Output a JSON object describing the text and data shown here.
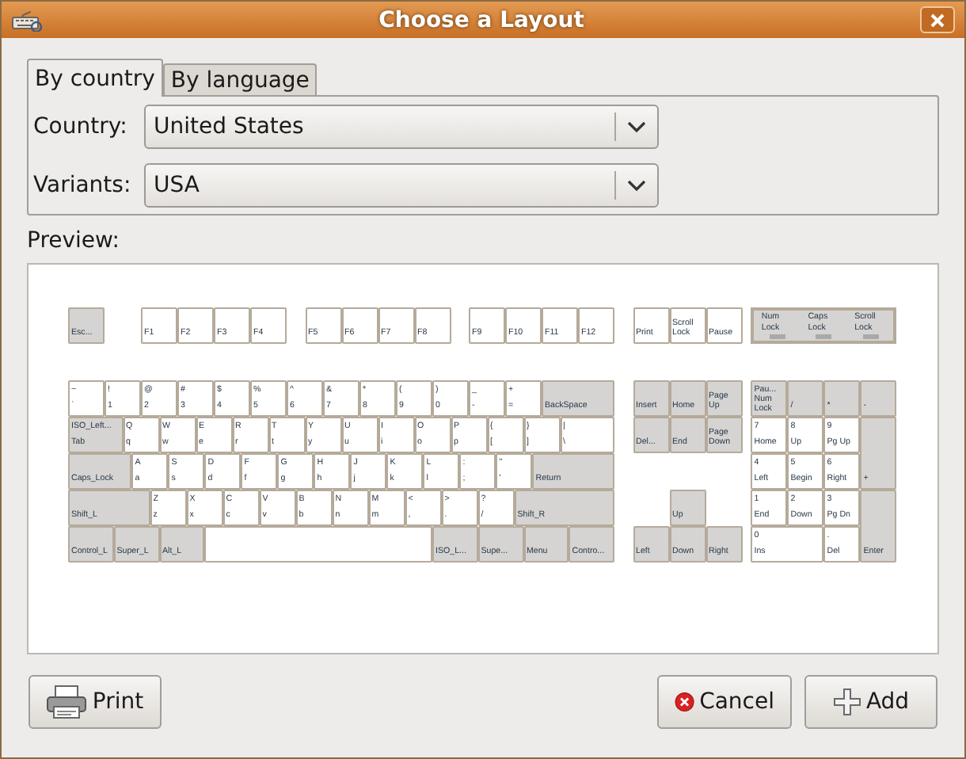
{
  "window": {
    "title": "Choose a Layout"
  },
  "tabs": [
    {
      "label": "By country",
      "selected": true
    },
    {
      "label": "By language",
      "selected": false
    }
  ],
  "fields": [
    {
      "label": "Country:",
      "value": "United States"
    },
    {
      "label": "Variants:",
      "value": "USA"
    }
  ],
  "preview": {
    "label": "Preview:",
    "keyboard": {
      "function_row": [
        {
          "kind": "mod",
          "labels": [
            "Esc..."
          ]
        },
        {
          "kind": "char",
          "labels": [
            "F1"
          ]
        },
        {
          "kind": "char",
          "labels": [
            "F2"
          ]
        },
        {
          "kind": "char",
          "labels": [
            "F3"
          ]
        },
        {
          "kind": "char",
          "labels": [
            "F4"
          ]
        },
        {
          "kind": "char",
          "labels": [
            "F5"
          ]
        },
        {
          "kind": "char",
          "labels": [
            "F6"
          ]
        },
        {
          "kind": "char",
          "labels": [
            "F7"
          ]
        },
        {
          "kind": "char",
          "labels": [
            "F8"
          ]
        },
        {
          "kind": "char",
          "labels": [
            "F9"
          ]
        },
        {
          "kind": "char",
          "labels": [
            "F10"
          ]
        },
        {
          "kind": "char",
          "labels": [
            "F11"
          ]
        },
        {
          "kind": "char",
          "labels": [
            "F12"
          ]
        },
        {
          "kind": "char",
          "labels": [
            "Print"
          ]
        },
        {
          "kind": "char",
          "labels": [
            "Scroll Lock"
          ]
        },
        {
          "kind": "char",
          "labels": [
            "Pause"
          ]
        }
      ],
      "indicators": [
        {
          "label": "Num Lock",
          "on": false
        },
        {
          "label": "Caps Lock",
          "on": false
        },
        {
          "label": "Scroll Lock",
          "on": false
        }
      ],
      "main_rows": [
        [
          {
            "kind": "char",
            "labels": [
              "~",
              "`"
            ]
          },
          {
            "kind": "char",
            "labels": [
              "!",
              "1"
            ]
          },
          {
            "kind": "char",
            "labels": [
              "@",
              "2"
            ]
          },
          {
            "kind": "char",
            "labels": [
              "#",
              "3"
            ]
          },
          {
            "kind": "char",
            "labels": [
              "$",
              "4"
            ]
          },
          {
            "kind": "char",
            "labels": [
              "%",
              "5"
            ]
          },
          {
            "kind": "char",
            "labels": [
              "^",
              "6"
            ]
          },
          {
            "kind": "char",
            "labels": [
              "&",
              "7"
            ]
          },
          {
            "kind": "char",
            "labels": [
              "*",
              "8"
            ]
          },
          {
            "kind": "char",
            "labels": [
              "(",
              "9"
            ]
          },
          {
            "kind": "char",
            "labels": [
              ")",
              "0"
            ]
          },
          {
            "kind": "char",
            "labels": [
              "_",
              "-"
            ]
          },
          {
            "kind": "char",
            "labels": [
              "+",
              "="
            ]
          },
          {
            "kind": "mod",
            "labels": [
              "BackSpace"
            ]
          }
        ],
        [
          {
            "kind": "mod",
            "labels": [
              "ISO_Left...",
              "Tab"
            ]
          },
          {
            "kind": "char",
            "labels": [
              "Q",
              "q"
            ]
          },
          {
            "kind": "char",
            "labels": [
              "W",
              "w"
            ]
          },
          {
            "kind": "char",
            "labels": [
              "E",
              "e"
            ]
          },
          {
            "kind": "char",
            "labels": [
              "R",
              "r"
            ]
          },
          {
            "kind": "char",
            "labels": [
              "T",
              "t"
            ]
          },
          {
            "kind": "char",
            "labels": [
              "Y",
              "y"
            ]
          },
          {
            "kind": "char",
            "labels": [
              "U",
              "u"
            ]
          },
          {
            "kind": "char",
            "labels": [
              "I",
              "i"
            ]
          },
          {
            "kind": "char",
            "labels": [
              "O",
              "o"
            ]
          },
          {
            "kind": "char",
            "labels": [
              "P",
              "p"
            ]
          },
          {
            "kind": "char",
            "labels": [
              "{",
              "["
            ]
          },
          {
            "kind": "char",
            "labels": [
              "}",
              "]"
            ]
          },
          {
            "kind": "char",
            "labels": [
              "|",
              "\\"
            ]
          }
        ],
        [
          {
            "kind": "mod",
            "labels": [
              "Caps_Lock"
            ]
          },
          {
            "kind": "char",
            "labels": [
              "A",
              "a"
            ]
          },
          {
            "kind": "char",
            "labels": [
              "S",
              "s"
            ]
          },
          {
            "kind": "char",
            "labels": [
              "D",
              "d"
            ]
          },
          {
            "kind": "char",
            "labels": [
              "F",
              "f"
            ]
          },
          {
            "kind": "char",
            "labels": [
              "G",
              "g"
            ]
          },
          {
            "kind": "char",
            "labels": [
              "H",
              "h"
            ]
          },
          {
            "kind": "char",
            "labels": [
              "J",
              "j"
            ]
          },
          {
            "kind": "char",
            "labels": [
              "K",
              "k"
            ]
          },
          {
            "kind": "char",
            "labels": [
              "L",
              "l"
            ]
          },
          {
            "kind": "char",
            "labels": [
              ":",
              ";"
            ]
          },
          {
            "kind": "char",
            "labels": [
              "\"",
              "'"
            ]
          },
          {
            "kind": "mod",
            "labels": [
              "Return"
            ]
          }
        ],
        [
          {
            "kind": "mod",
            "labels": [
              "Shift_L"
            ]
          },
          {
            "kind": "char",
            "labels": [
              "Z",
              "z"
            ]
          },
          {
            "kind": "char",
            "labels": [
              "X",
              "x"
            ]
          },
          {
            "kind": "char",
            "labels": [
              "C",
              "c"
            ]
          },
          {
            "kind": "char",
            "labels": [
              "V",
              "v"
            ]
          },
          {
            "kind": "char",
            "labels": [
              "B",
              "b"
            ]
          },
          {
            "kind": "char",
            "labels": [
              "N",
              "n"
            ]
          },
          {
            "kind": "char",
            "labels": [
              "M",
              "m"
            ]
          },
          {
            "kind": "char",
            "labels": [
              "<",
              ","
            ]
          },
          {
            "kind": "char",
            "labels": [
              ">",
              "."
            ]
          },
          {
            "kind": "char",
            "labels": [
              "?",
              "/"
            ]
          },
          {
            "kind": "mod",
            "labels": [
              "Shift_R"
            ]
          }
        ],
        [
          {
            "kind": "mod",
            "labels": [
              "Control_L"
            ]
          },
          {
            "kind": "mod",
            "labels": [
              "Super_L"
            ]
          },
          {
            "kind": "mod",
            "labels": [
              "Alt_L"
            ]
          },
          {
            "kind": "char"
          },
          {
            "kind": "mod",
            "labels": [
              "ISO_L..."
            ]
          },
          {
            "kind": "mod",
            "labels": [
              "Supe..."
            ]
          },
          {
            "kind": "mod",
            "labels": [
              "Menu"
            ]
          },
          {
            "kind": "mod",
            "labels": [
              "Contro..."
            ]
          }
        ]
      ],
      "navigation": [
        {
          "kind": "mod",
          "labels": [
            "Insert"
          ]
        },
        {
          "kind": "mod",
          "labels": [
            "Home"
          ]
        },
        {
          "kind": "mod",
          "labels": [
            "Page Up"
          ]
        },
        {
          "kind": "mod",
          "labels": [
            "Del..."
          ]
        },
        {
          "kind": "mod",
          "labels": [
            "End"
          ]
        },
        {
          "kind": "mod",
          "labels": [
            "Page Down"
          ]
        },
        {
          "kind": "mod",
          "labels": [
            "Up"
          ]
        },
        {
          "kind": "mod",
          "labels": [
            "Left"
          ]
        },
        {
          "kind": "mod",
          "labels": [
            "Down"
          ]
        },
        {
          "kind": "mod",
          "labels": [
            "Right"
          ]
        }
      ],
      "numpad": [
        {
          "kind": "mod",
          "labels": [
            "Pau...",
            "Num Lock"
          ]
        },
        {
          "kind": "mod",
          "labels": [
            "/"
          ]
        },
        {
          "kind": "mod",
          "labels": [
            "*"
          ]
        },
        {
          "kind": "mod",
          "labels": [
            "-"
          ]
        },
        {
          "kind": "char",
          "labels": [
            "7",
            "Home"
          ]
        },
        {
          "kind": "char",
          "labels": [
            "8",
            "Up"
          ]
        },
        {
          "kind": "char",
          "labels": [
            "9",
            "Pg Up"
          ]
        },
        {
          "kind": "char",
          "labels": [
            "4",
            "Left"
          ]
        },
        {
          "kind": "char",
          "labels": [
            "5",
            "Begin"
          ]
        },
        {
          "kind": "char",
          "labels": [
            "6",
            "Right"
          ]
        },
        {
          "kind": "mod",
          "labels": [
            "+"
          ]
        },
        {
          "kind": "char",
          "labels": [
            "1",
            "End"
          ]
        },
        {
          "kind": "char",
          "labels": [
            "2",
            "Down"
          ]
        },
        {
          "kind": "char",
          "labels": [
            "3",
            "Pg Dn"
          ]
        },
        {
          "kind": "char",
          "labels": [
            "0",
            "Ins"
          ]
        },
        {
          "kind": "char",
          "labels": [
            ".",
            "Del"
          ]
        },
        {
          "kind": "mod",
          "labels": [
            "Enter"
          ]
        }
      ]
    }
  },
  "buttons": [
    {
      "label": "Print",
      "kind": "print"
    },
    {
      "label": "Cancel",
      "kind": "cancel"
    },
    {
      "label": "Add",
      "kind": "add"
    }
  ]
}
